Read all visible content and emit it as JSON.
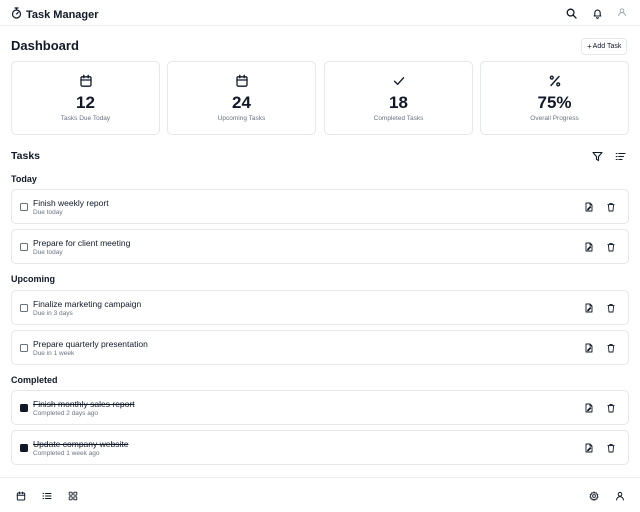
{
  "header": {
    "title": "Task Manager",
    "icons": [
      "stopwatch-icon",
      "search-icon",
      "bell-icon",
      "user-icon"
    ]
  },
  "dashboard": {
    "title": "Dashboard",
    "add_label": "Add Task"
  },
  "stats": [
    {
      "icon": "calendar-icon",
      "value": "12",
      "label": "Tasks Due Today"
    },
    {
      "icon": "calendar-icon",
      "value": "24",
      "label": "Upcoming Tasks"
    },
    {
      "icon": "check-icon",
      "value": "18",
      "label": "Completed Tasks"
    },
    {
      "icon": "percent-icon",
      "value": "75%",
      "label": "Overall Progress"
    }
  ],
  "tasks_section": {
    "title": "Tasks",
    "icons": [
      "filter-icon",
      "sort-icon"
    ]
  },
  "groups": [
    {
      "label": "Today",
      "tasks": [
        {
          "title": "Finish weekly report",
          "sub": "Due today",
          "completed": false
        },
        {
          "title": "Prepare for client meeting",
          "sub": "Due today",
          "completed": false
        }
      ]
    },
    {
      "label": "Upcoming",
      "tasks": [
        {
          "title": "Finalize marketing campaign",
          "sub": "Due in 3 days",
          "completed": false
        },
        {
          "title": "Prepare quarterly presentation",
          "sub": "Due in 1 week",
          "completed": false
        }
      ]
    },
    {
      "label": "Completed",
      "tasks": [
        {
          "title": "Finish monthly sales report",
          "sub": "Completed 2 days ago",
          "completed": true
        },
        {
          "title": "Update company website",
          "sub": "Completed 1 week ago",
          "completed": true
        }
      ]
    }
  ],
  "bottom_nav": {
    "left_icons": [
      "calendar-icon",
      "list-icon",
      "grid-icon"
    ],
    "right_icons": [
      "settings-icon",
      "profile-icon"
    ]
  }
}
